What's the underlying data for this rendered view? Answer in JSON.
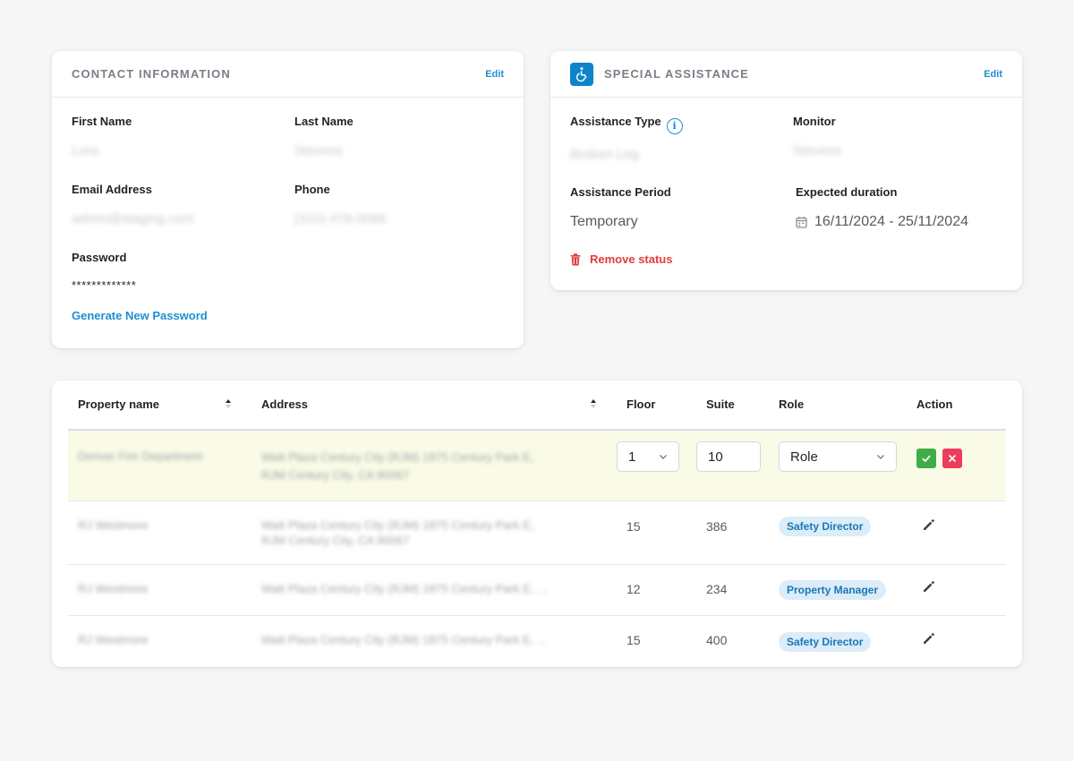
{
  "contact": {
    "title": "CONTACT INFORMATION",
    "edit": "Edit",
    "first_name_label": "First Name",
    "first_name_value": "Lora",
    "last_name_label": "Last Name",
    "last_name_value": "Stevens",
    "email_label": "Email Address",
    "email_value": "admin@staging.com",
    "phone_label": "Phone",
    "phone_value": "(310) 478-0066",
    "password_label": "Password",
    "password_value": "*************",
    "generate_password": "Generate New Password"
  },
  "assistance": {
    "title": "SPECIAL ASSISTANCE",
    "edit": "Edit",
    "type_label": "Assistance Type",
    "type_value": "Broken Leg",
    "monitor_label": "Monitor",
    "monitor_value": "Stevens",
    "period_label": "Assistance Period",
    "period_value": "Temporary",
    "duration_label": "Expected duration",
    "duration_value": "16/11/2024 - 25/11/2024",
    "remove_status": "Remove status",
    "icon": "wheelchair-icon"
  },
  "table": {
    "headers": {
      "property": "Property name",
      "address": "Address",
      "floor": "Floor",
      "suite": "Suite",
      "role": "Role",
      "action": "Action"
    },
    "editing_row": {
      "property": "Denver Fire Department",
      "address_line1": "Watt Plaza Century City (RJM) 1875 Century Park E,",
      "address_line2": "RJM Century City, CA 90067",
      "floor_value": "1",
      "suite_value": "10",
      "role_placeholder": "Role"
    },
    "rows": [
      {
        "property": "RJ Westmore",
        "address_line1": "Watt Plaza Century City (RJM) 1875 Century Park E,",
        "address_line2": "RJM Century City, CA 90067",
        "floor": "15",
        "suite": "386",
        "role": "Safety Director"
      },
      {
        "property": "RJ Westmore",
        "address_line1": "Watt Plaza Century City (RJM) 1875 Century Park E, ...",
        "address_line2": "",
        "floor": "12",
        "suite": "234",
        "role": "Property Manager"
      },
      {
        "property": "RJ Westmore",
        "address_line1": "Watt Plaza Century City (RJM) 1875 Century Park E, ...",
        "address_line2": "",
        "floor": "15",
        "suite": "400",
        "role": "Safety Director"
      }
    ]
  },
  "colors": {
    "accent": "#1d8fd0",
    "danger": "#e23b3b",
    "confirm": "#3fae49",
    "cancel": "#ec3d5c",
    "editing_row_bg": "#fafbe6",
    "badge_bg": "#dcecf8"
  }
}
